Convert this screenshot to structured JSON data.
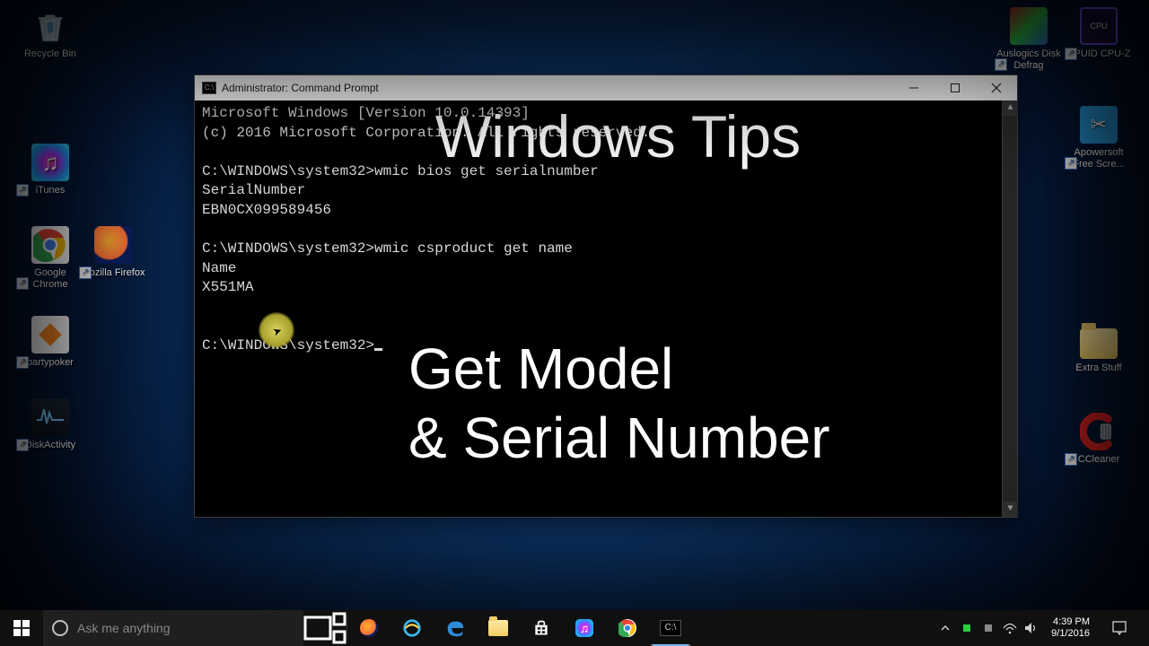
{
  "desktop": {
    "icons_left": [
      {
        "id": "recycle-bin",
        "label": "Recycle Bin"
      },
      {
        "id": "itunes",
        "label": "iTunes"
      },
      {
        "id": "chrome",
        "label": "Google Chrome"
      },
      {
        "id": "firefox",
        "label": "Mozilla Firefox"
      },
      {
        "id": "partypoker",
        "label": "partypoker"
      },
      {
        "id": "diskactivity",
        "label": "DiskActivity"
      }
    ],
    "icons_right": [
      {
        "id": "auslogics",
        "label": "Auslogics Disk Defrag"
      },
      {
        "id": "cpuz",
        "label": "CPUID CPU-Z"
      },
      {
        "id": "apowersoft",
        "label": "Apowersoft Free Scre..."
      },
      {
        "id": "extra-stuff",
        "label": "Extra Stuff"
      },
      {
        "id": "ccleaner",
        "label": "CCleaner"
      }
    ]
  },
  "cmd": {
    "title": "Administrator: Command Prompt",
    "lines": [
      "Microsoft Windows [Version 10.0.14393]",
      "(c) 2016 Microsoft Corporation. All rights reserved.",
      "",
      "C:\\WINDOWS\\system32>wmic bios get serialnumber",
      "SerialNumber",
      "EBN0CX099589456",
      "",
      "C:\\WINDOWS\\system32>wmic csproduct get name",
      "Name",
      "X551MA",
      "",
      "",
      "C:\\WINDOWS\\system32>"
    ]
  },
  "overlay": {
    "line1": "Windows Tips",
    "line2": "Get Model",
    "line3": "& Serial Number"
  },
  "taskbar": {
    "search_placeholder": "Ask me anything",
    "clock_time": "4:39 PM",
    "clock_date": "9/1/2016"
  }
}
